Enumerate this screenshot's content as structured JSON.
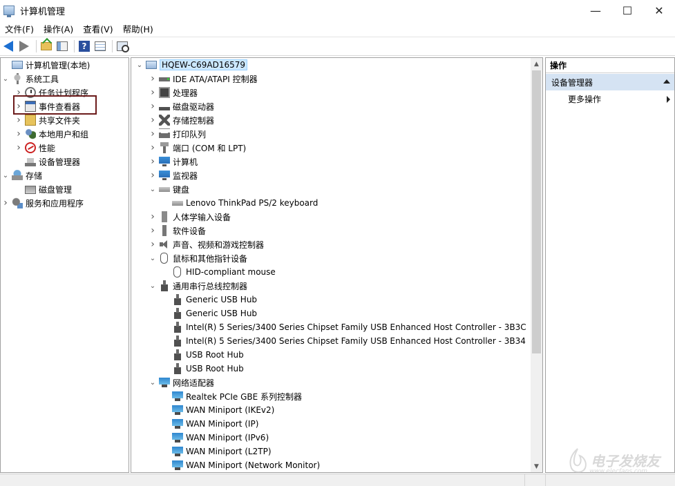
{
  "window": {
    "title": "计算机管理",
    "minimize": "—",
    "maximize": "☐",
    "close": "✕"
  },
  "menu": [
    "文件(F)",
    "操作(A)",
    "查看(V)",
    "帮助(H)"
  ],
  "toolbar": {
    "help_label": "?"
  },
  "left_tree": [
    {
      "label": "计算机管理(本地)",
      "level": 0,
      "expander": "",
      "icon": "computer-icon"
    },
    {
      "label": "系统工具",
      "level": 0,
      "expander": "open",
      "icon": "tools-icon"
    },
    {
      "label": "任务计划程序",
      "level": 1,
      "expander": "closed",
      "icon": "clock-icon"
    },
    {
      "label": "事件查看器",
      "level": 1,
      "expander": "closed",
      "icon": "event-icon"
    },
    {
      "label": "共享文件夹",
      "level": 1,
      "expander": "closed",
      "icon": "share-icon"
    },
    {
      "label": "本地用户和组",
      "level": 1,
      "expander": "closed",
      "icon": "users-icon"
    },
    {
      "label": "性能",
      "level": 1,
      "expander": "closed",
      "icon": "performance-icon"
    },
    {
      "label": "设备管理器",
      "level": 1,
      "expander": "",
      "icon": "device-manager-icon"
    },
    {
      "label": "存储",
      "level": 0,
      "expander": "open",
      "icon": "storage-icon"
    },
    {
      "label": "磁盘管理",
      "level": 1,
      "expander": "",
      "icon": "disk-icon"
    },
    {
      "label": "服务和应用程序",
      "level": 0,
      "expander": "closed",
      "icon": "services-icon"
    }
  ],
  "device_tree": [
    {
      "label": "HQEW-C69AD16579",
      "level": 0,
      "expander": "open",
      "icon": "computer-icon"
    },
    {
      "label": "IDE ATA/ATAPI 控制器",
      "level": 1,
      "expander": "closed",
      "icon": "ide-icon"
    },
    {
      "label": "处理器",
      "level": 1,
      "expander": "closed",
      "icon": "cpu-icon"
    },
    {
      "label": "磁盘驱动器",
      "level": 1,
      "expander": "closed",
      "icon": "drive-icon"
    },
    {
      "label": "存储控制器",
      "level": 1,
      "expander": "closed",
      "icon": "storage-controller-icon"
    },
    {
      "label": "打印队列",
      "level": 1,
      "expander": "closed",
      "icon": "printer-icon"
    },
    {
      "label": "端口 (COM 和 LPT)",
      "level": 1,
      "expander": "closed",
      "icon": "port-icon"
    },
    {
      "label": "计算机",
      "level": 1,
      "expander": "closed",
      "icon": "monitor-icon"
    },
    {
      "label": "监视器",
      "level": 1,
      "expander": "closed",
      "icon": "monitor-icon"
    },
    {
      "label": "键盘",
      "level": 1,
      "expander": "open",
      "icon": "keyboard-icon"
    },
    {
      "label": "Lenovo ThinkPad PS/2 keyboard",
      "level": 2,
      "expander": "",
      "icon": "keyboard-icon"
    },
    {
      "label": "人体学输入设备",
      "level": 1,
      "expander": "closed",
      "icon": "hid-icon"
    },
    {
      "label": "软件设备",
      "level": 1,
      "expander": "closed",
      "icon": "software-device-icon"
    },
    {
      "label": "声音、视频和游戏控制器",
      "level": 1,
      "expander": "closed",
      "icon": "sound-icon"
    },
    {
      "label": "鼠标和其他指针设备",
      "level": 1,
      "expander": "open",
      "icon": "mouse-icon"
    },
    {
      "label": "HID-compliant mouse",
      "level": 2,
      "expander": "",
      "icon": "mouse-icon"
    },
    {
      "label": "通用串行总线控制器",
      "level": 1,
      "expander": "open",
      "icon": "usb-icon"
    },
    {
      "label": "Generic USB Hub",
      "level": 2,
      "expander": "",
      "icon": "usb-icon"
    },
    {
      "label": "Generic USB Hub",
      "level": 2,
      "expander": "",
      "icon": "usb-icon"
    },
    {
      "label": "Intel(R) 5 Series/3400 Series Chipset Family USB Enhanced Host Controller - 3B3C",
      "level": 2,
      "expander": "",
      "icon": "usb-icon"
    },
    {
      "label": "Intel(R) 5 Series/3400 Series Chipset Family USB Enhanced Host Controller - 3B34",
      "level": 2,
      "expander": "",
      "icon": "usb-icon"
    },
    {
      "label": "USB Root Hub",
      "level": 2,
      "expander": "",
      "icon": "usb-icon"
    },
    {
      "label": "USB Root Hub",
      "level": 2,
      "expander": "",
      "icon": "usb-icon"
    },
    {
      "label": "网络适配器",
      "level": 1,
      "expander": "open",
      "icon": "network-adapter-icon"
    },
    {
      "label": "Realtek PCIe GBE 系列控制器",
      "level": 2,
      "expander": "",
      "icon": "network-adapter-icon"
    },
    {
      "label": "WAN Miniport (IKEv2)",
      "level": 2,
      "expander": "",
      "icon": "network-adapter-icon"
    },
    {
      "label": "WAN Miniport (IP)",
      "level": 2,
      "expander": "",
      "icon": "network-adapter-icon"
    },
    {
      "label": "WAN Miniport (IPv6)",
      "level": 2,
      "expander": "",
      "icon": "network-adapter-icon"
    },
    {
      "label": "WAN Miniport (L2TP)",
      "level": 2,
      "expander": "",
      "icon": "network-adapter-icon"
    },
    {
      "label": "WAN Miniport (Network Monitor)",
      "level": 2,
      "expander": "",
      "icon": "network-adapter-icon"
    }
  ],
  "actions": {
    "header": "操作",
    "section": "设备管理器",
    "more": "更多操作"
  },
  "watermark": {
    "text": "电子发烧友",
    "url": "www.elecfans.com"
  }
}
